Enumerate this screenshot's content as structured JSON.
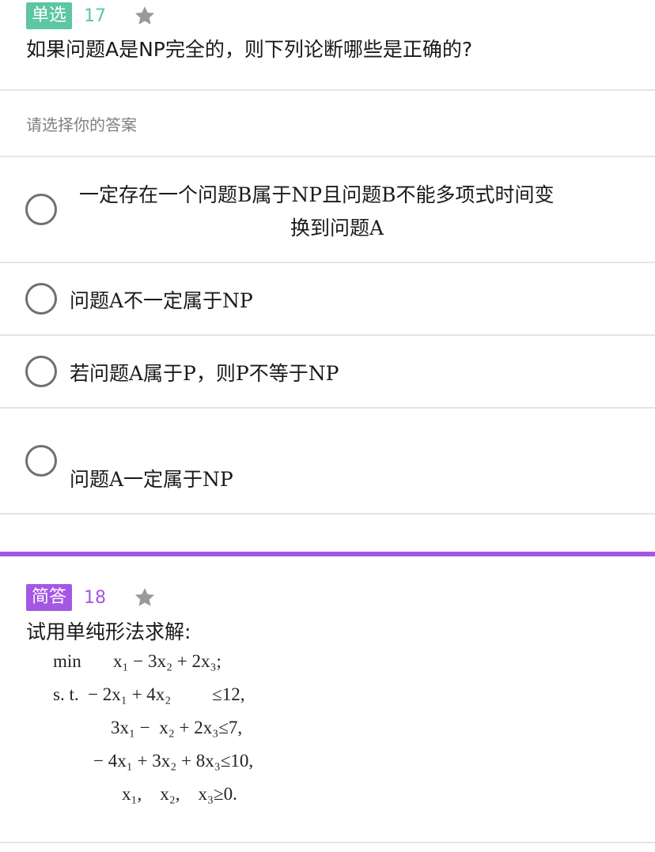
{
  "q17": {
    "type_label": "单选",
    "number": "17",
    "question": "如果问题A是NP完全的，则下列论断哪些是正确的?",
    "prompt": "请选择你的答案",
    "options": [
      {
        "line1": "一定存在一个问题B属于NP且问题B不能多项式时间变",
        "line2": "换到问题A"
      },
      {
        "text": "问题A不一定属于NP"
      },
      {
        "text": "若问题A属于P，则P不等于NP"
      },
      {
        "text": "问题A一定属于NP"
      }
    ]
  },
  "q18": {
    "type_label": "简答",
    "number": "18",
    "question": "试用单纯形法求解:",
    "image_lines": [
      "min       x₁ − 3x₂ + 2x₃;",
      "s. t.  − 2x₁ + 4x₂         ≤12,",
      "3x₁ −  x₂ + 2x₃≤7,",
      "− 4x₁ + 3x₂ + 8x₃≤10,",
      "x₁,    x₂,    x₃≥0."
    ]
  },
  "colors": {
    "single_choice_accent": "#5cc7a0",
    "short_answer_accent": "#a457e3",
    "star": "#9a9a9a"
  },
  "icons": {
    "favorite": "star-icon",
    "option_selector": "radio-circle"
  }
}
